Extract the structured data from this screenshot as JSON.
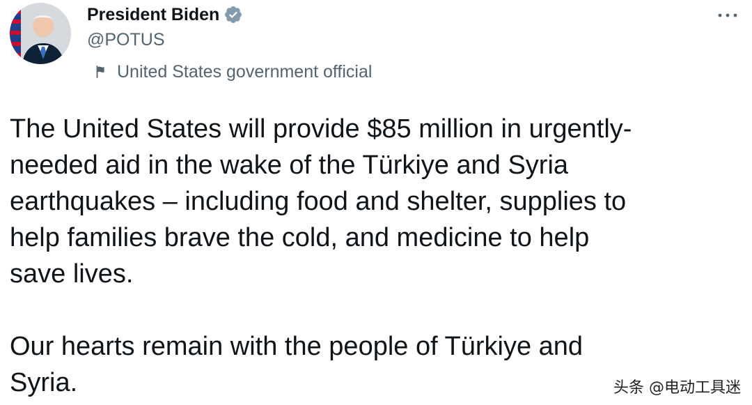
{
  "author": {
    "display_name": "President Biden",
    "handle": "@POTUS",
    "verified": true,
    "avatar": "portrait-avatar",
    "label_icon": "flag-icon",
    "label_text": "United States government official"
  },
  "menu": {
    "icon": "more-icon"
  },
  "tweet": {
    "paragraph_1": "The United States will provide $85 million in urgently-\nneeded aid in the wake of the Türkiye and Syria\nearthquakes – including food and shelter, supplies to\nhelp families brave the cold, and medicine to help\nsave lives.",
    "paragraph_2": "Our hearts remain with the people of Türkiye and\nSyria."
  },
  "watermark": {
    "text": "头条 @电动工具迷"
  },
  "colors": {
    "name": "#0f1419",
    "secondary": "#536471",
    "verified": "#1d9bf0",
    "body": "#0f1419",
    "background": "#ffffff"
  }
}
